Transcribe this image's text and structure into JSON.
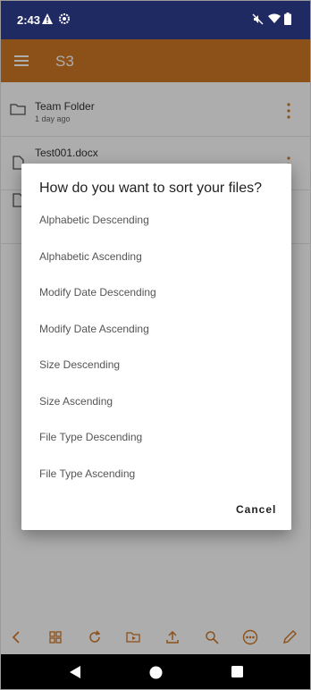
{
  "status_bar": {
    "time": "2:43"
  },
  "app_bar": {
    "title": "S3"
  },
  "files": [
    {
      "name": "Team Folder",
      "sub": "1 day ago",
      "kind": "folder"
    },
    {
      "name": "Test001.docx",
      "sub": "",
      "kind": "document"
    },
    {
      "name": "",
      "sub": "",
      "kind": "document"
    }
  ],
  "dialog": {
    "title": "How do you want to sort your files?",
    "options": [
      "Alphabetic Descending",
      "Alphabetic Ascending",
      "Modify Date Descending",
      "Modify Date Ascending",
      "Size Descending",
      "Size Ascending",
      "File Type Descending",
      "File Type Ascending"
    ],
    "cancel": "Cancel"
  },
  "colors": {
    "status_bar": "#1f2a63",
    "app_bar": "#cf7626",
    "accent": "#cf7626"
  }
}
